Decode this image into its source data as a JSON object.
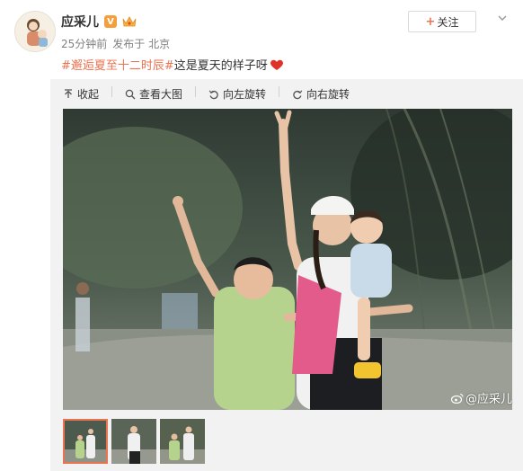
{
  "user": {
    "name": "应采儿",
    "verified_badge": "V",
    "avatar_icon": "avatar-illustration",
    "crown_icon": "vip-crown-icon"
  },
  "post": {
    "time": "25分钟前",
    "source": "发布于 北京",
    "hashtag": "#邂逅夏至十二时辰#",
    "text": " 这是夏天的样子呀"
  },
  "follow": {
    "plus": "+",
    "label": "关注"
  },
  "toolbar": {
    "collapse": "收起",
    "view_large": "查看大图",
    "rotate_left": "向左旋转",
    "rotate_right": "向右旋转"
  },
  "watermark": "@应采儿",
  "colors": {
    "accent": "#eb7350",
    "badge": "#f3a03c",
    "heart": "#e0322a"
  }
}
